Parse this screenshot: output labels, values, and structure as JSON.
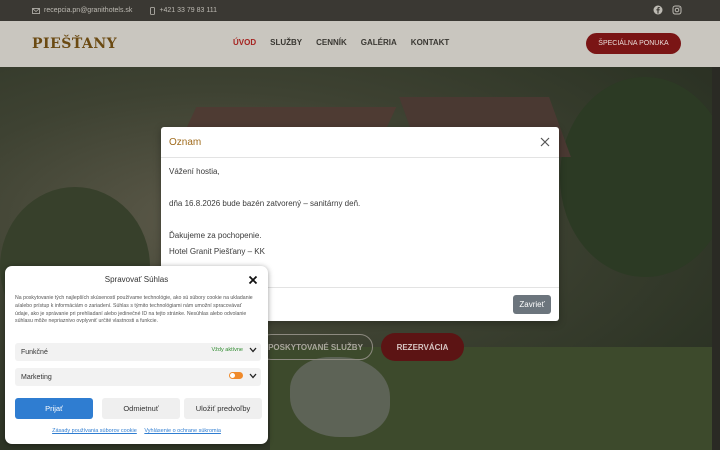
{
  "topbar": {
    "email": "recepcia.pn@granithotels.sk",
    "phone": "+421 33 79 83 111",
    "social_icons": [
      "facebook-icon",
      "instagram-icon"
    ]
  },
  "header": {
    "logo": "PIEŠŤANY",
    "nav": [
      {
        "label": "ÚVOD",
        "active": true
      },
      {
        "label": "SLUŽBY",
        "active": false
      },
      {
        "label": "CENNÍK",
        "active": false
      },
      {
        "label": "GALÉRIA",
        "active": false
      },
      {
        "label": "KONTAKT",
        "active": false
      }
    ],
    "special_offer": "ŠPECIÁLNA PONUKA"
  },
  "hero": {
    "services_button": "POSKYTOVANÉ SLUŽBY",
    "booking_button": "REZERVÁCIA"
  },
  "modal": {
    "title": "Oznam",
    "lines": [
      "Vážení hostia,",
      "dňa 16.8.2026 bude bazén zatvorený – sanitárny deň.",
      "Ďakujeme za pochopenie.",
      "Hotel Granit Piešťany – KK"
    ],
    "close_button": "Zavrieť"
  },
  "cookie": {
    "title": "Spravovať Súhlas",
    "text": "Na poskytovanie tých najlepších skúseností používame technológie, ako sú súbory cookie na ukladanie a/alebo prístup k informáciám o zariadení. Súhlas s týmito technológiami nám umožní spracovávať údaje, ako je správanie pri prehliadaní alebo jedinečné ID na tejto stránke. Nesúhlas alebo odvolanie súhlasu môže nepriaznivo ovplyvniť určité vlastnosti a funkcie.",
    "functional_label": "Funkčné",
    "functional_status": "Vždy aktívne",
    "marketing_label": "Marketing",
    "accept": "Prijať",
    "deny": "Odmietnuť",
    "preferences": "Uložiť predvoľby",
    "link_cookies": "Zásady používania súborov cookie",
    "link_privacy": "Vyhlásenie o ochrane súkromia"
  },
  "colors": {
    "accent": "#7a1515",
    "nav_active": "#a5221f",
    "logo": "#6b4a12",
    "cookie_accept": "#2f7dd1",
    "toggle_on": "#f08a2a"
  }
}
